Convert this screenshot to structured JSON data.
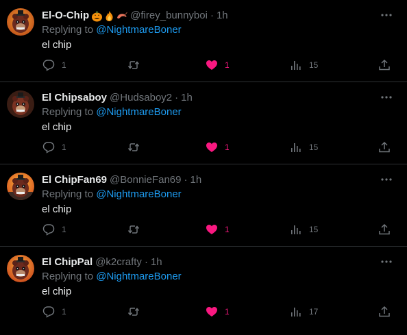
{
  "reply_prefix": "Replying to ",
  "tweets": [
    {
      "display_name": "El-O-Chip",
      "emojis": [
        "jack-o-lantern",
        "fire",
        "shrimp"
      ],
      "handle": "@firey_bunnyboi",
      "separator": "·",
      "time": "1h",
      "replying_to": "@NightmareBoner",
      "text": "el chip",
      "replies": "1",
      "retweets": "",
      "likes": "1",
      "views": "15"
    },
    {
      "display_name": "El Chipsaboy",
      "emojis": [],
      "handle": "@Hudsaboy2",
      "separator": "·",
      "time": "1h",
      "replying_to": "@NightmareBoner",
      "text": "el chip",
      "replies": "1",
      "retweets": "",
      "likes": "1",
      "views": "15"
    },
    {
      "display_name": "El ChipFan69",
      "emojis": [],
      "handle": "@BonnieFan69",
      "separator": "·",
      "time": "1h",
      "replying_to": "@NightmareBoner",
      "text": "el chip",
      "replies": "1",
      "retweets": "",
      "likes": "1",
      "views": "15"
    },
    {
      "display_name": "El ChipPal",
      "emojis": [],
      "handle": "@k2crafty",
      "separator": "·",
      "time": "1h",
      "replying_to": "@NightmareBoner",
      "text": "el chip",
      "replies": "1",
      "retweets": "",
      "likes": "1",
      "views": "17"
    }
  ],
  "colors": {
    "background": "#000000",
    "text": "#e7e9ea",
    "muted": "#71767b",
    "link": "#1d9bf0",
    "like": "#f91880",
    "divider": "#2f3336"
  },
  "icons": {
    "more": "more-horizontal-icon",
    "reply": "reply-bubble-icon",
    "retweet": "retweet-icon",
    "like": "heart-filled-icon",
    "views": "views-bar-chart-icon",
    "share": "share-upload-icon"
  }
}
